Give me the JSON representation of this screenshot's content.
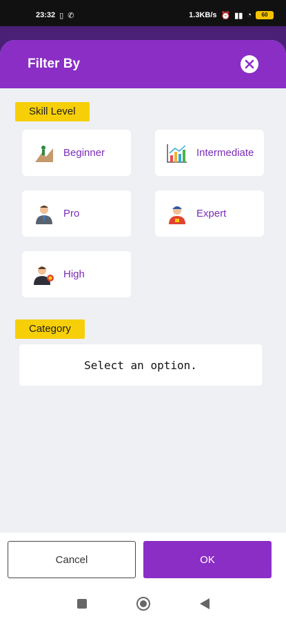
{
  "status": {
    "time": "23:32",
    "speed": "1.3KB/s",
    "battery": "60"
  },
  "header": {
    "title": "Filter By"
  },
  "skill": {
    "label": "Skill Level",
    "options": [
      "Beginner",
      "Intermediate",
      "Pro",
      "Expert",
      "High"
    ]
  },
  "category": {
    "label": "Category",
    "placeholder": "Select an option."
  },
  "footer": {
    "cancel_label": "Cancel",
    "ok_label": "OK"
  },
  "colors": {
    "accent": "#8a2ec6",
    "tag": "#f6cf08",
    "option_text": "#7a2bb8"
  }
}
